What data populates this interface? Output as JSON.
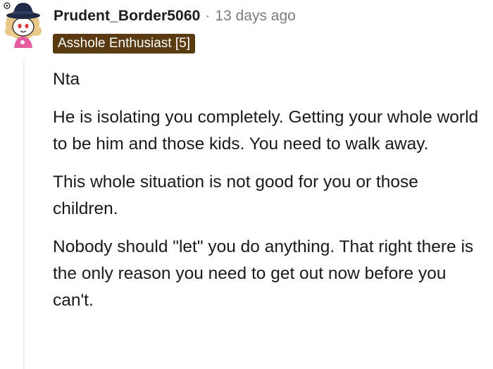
{
  "comment": {
    "username": "Prudent_Border5060",
    "separator": "·",
    "timestamp": "13 days ago",
    "flair": "Asshole Enthusiast [5]",
    "paragraphs": [
      "Nta",
      "He is isolating you completely. Getting your whole world to be him and those kids. You need to walk away.",
      "This whole situation is not good for you or those children.",
      "Nobody should \"let\" you do anything. That right there is the only reason you need to get out now before you can't."
    ]
  },
  "colors": {
    "flair_bg": "#5a3a10",
    "meta_text": "#7c7c7c",
    "body_text": "#1a1a1b",
    "thread_line": "#edeff1"
  },
  "icons": {
    "avatar": "snoo-avatar-with-hat"
  }
}
